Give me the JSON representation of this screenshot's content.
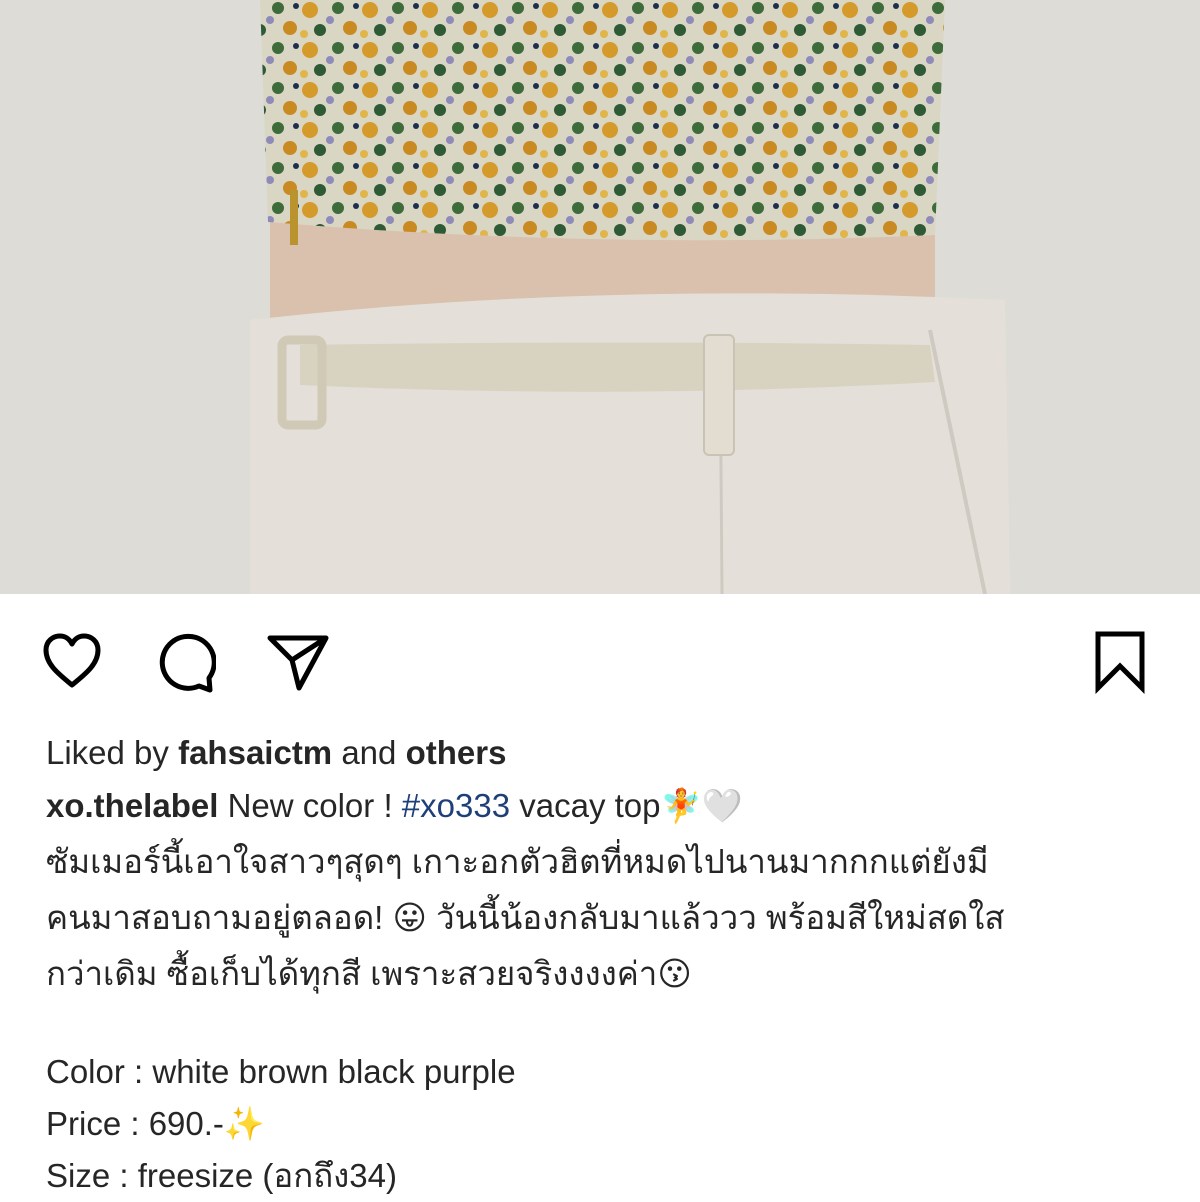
{
  "post": {
    "image_alt": "Model wearing floral smocked top with cream pants and belt",
    "liked_by": {
      "prefix": "Liked by",
      "user": "fahsaictm",
      "conjunction": "and",
      "others": "others"
    },
    "caption": {
      "username": "xo.thelabel",
      "text_before": "New color !",
      "hashtag": "#xo333",
      "text_after": "vacay top",
      "emoji_fairy": "🧚",
      "emoji_heart": "🤍",
      "thai_line1": "ซัมเมอร์นี้เอาใจสาวๆสุดๆ เกาะอกตัวฮิตที่หมดไปนานมากกกแต่ยังมี",
      "thai_line2a": "คนมาสอบถามอยู่ตลอด!",
      "emoji_tongue": "😛",
      "thai_line2b": "วันนี้น้องกลับมาแล้ววว พร้อมสีใหม่สดใส",
      "thai_line3": "กว่าเดิม ซื้อเก็บได้ทุกสี เพราะสวยจริงงงงค่า",
      "emoji_kiss": "😗"
    },
    "details": {
      "color": "Color : white brown black purple",
      "price": "Price : 690.-",
      "emoji_sparkles": "✨",
      "size": "Size : freesize (อกถึง34)"
    }
  },
  "icons": {
    "like": "heart-icon",
    "comment": "comment-bubble-icon",
    "share": "paper-plane-icon",
    "save": "bookmark-icon"
  }
}
